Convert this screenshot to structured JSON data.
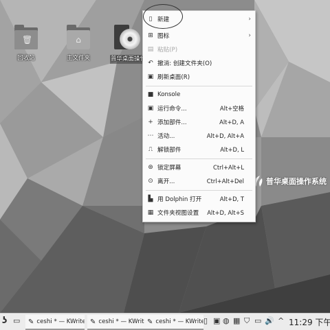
{
  "desktop": {
    "icons": [
      {
        "label": "回收站",
        "icon": "trash-folder-icon"
      },
      {
        "label": "主文件夹",
        "icon": "home-folder-icon"
      },
      {
        "label": "普华桌面操作系统安装程序",
        "icon": "installer-disc-icon"
      }
    ],
    "brand_text": "普华桌面操作系统"
  },
  "context_menu": {
    "items": [
      {
        "label": "新建",
        "icon": "new-document-icon",
        "submenu": true
      },
      {
        "label": "图标",
        "icon": "icons-view-icon",
        "submenu": true
      },
      {
        "label": "粘贴(P)",
        "icon": "paste-icon",
        "disabled": true
      },
      {
        "label": "撤消: 创建文件夹(O)",
        "icon": "undo-icon"
      },
      {
        "label": "刷新桌面(R)",
        "icon": "refresh-icon"
      },
      {
        "label": "Konsole",
        "icon": "terminal-icon"
      },
      {
        "label": "运行命令...",
        "icon": "run-command-icon",
        "shortcut": "Alt+空格"
      },
      {
        "label": "添加部件...",
        "icon": "add-widget-icon",
        "shortcut": "Alt+D, A"
      },
      {
        "label": "活动...",
        "icon": "activities-icon",
        "shortcut": "Alt+D, Alt+A"
      },
      {
        "label": "解锁部件",
        "icon": "unlock-icon",
        "shortcut": "Alt+D, L"
      },
      {
        "label": "锁定屏幕",
        "icon": "lock-screen-icon",
        "shortcut": "Ctrl+Alt+L"
      },
      {
        "label": "离开...",
        "icon": "leave-icon",
        "shortcut": "Ctrl+Alt+Del"
      },
      {
        "label": "用 Dolphin 打开",
        "icon": "dolphin-icon",
        "shortcut": "Alt+D, T"
      },
      {
        "label": "文件夹视图设置",
        "icon": "folder-view-settings-icon",
        "shortcut": "Alt+D, Alt+S"
      }
    ]
  },
  "taskbar": {
    "tasks": [
      {
        "label": "ceshi * — KWrite"
      },
      {
        "label": "ceshi * — KWrite"
      },
      {
        "label": "ceshi * — KWrite"
      }
    ],
    "clock": "11:29 下午",
    "tray_up_arrow": "^"
  }
}
